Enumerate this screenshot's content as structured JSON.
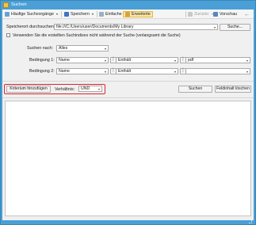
{
  "window": {
    "title": "Suchen"
  },
  "toolbar": {
    "saved_searches": "Häufige Suchvorgänge",
    "save": "Speichern",
    "simple": "Einfache",
    "advanced": "Erweiterte",
    "reset": "Zurückc",
    "preview": "Vorschau"
  },
  "location": {
    "label": "Speicherort durchsuchen:",
    "path": "file:///C:/Users/user/Documents/My Library",
    "browse_button": "Suche..."
  },
  "options": {
    "exclude_checkbox_label": "Verwenden Sie die erstellten Suchindizes nicht während der Suche (verlangsamt die Suche)",
    "exclude_checked": false
  },
  "search_by": {
    "label": "Suchen nach:",
    "value": "Alles"
  },
  "conditions": [
    {
      "label": "Bedingung 1:",
      "field": "Name",
      "operator": "Enthält",
      "value": "pdf"
    },
    {
      "label": "Bedingung 2:",
      "field": "Name",
      "operator": "Enthält",
      "value": ""
    }
  ],
  "criteria": {
    "add_button": "Kriterium hinzufügen",
    "relation_label": "Verhältnis:",
    "relation_value": "UND",
    "search_button": "Suchen",
    "clear_button": "Feldinhalt löschen"
  },
  "colors": {
    "title_bar": "#4a9fd6",
    "highlight_box": "#e0242b"
  }
}
